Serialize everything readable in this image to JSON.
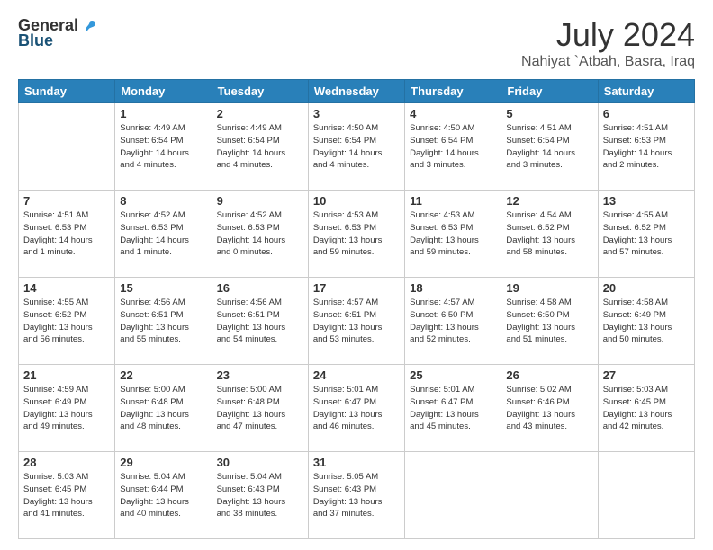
{
  "header": {
    "logo_general": "General",
    "logo_blue": "Blue",
    "month_year": "July 2024",
    "location": "Nahiyat `Atbah, Basra, Iraq"
  },
  "days_of_week": [
    "Sunday",
    "Monday",
    "Tuesday",
    "Wednesday",
    "Thursday",
    "Friday",
    "Saturday"
  ],
  "weeks": [
    [
      {
        "day": "",
        "info": ""
      },
      {
        "day": "1",
        "info": "Sunrise: 4:49 AM\nSunset: 6:54 PM\nDaylight: 14 hours\nand 4 minutes."
      },
      {
        "day": "2",
        "info": "Sunrise: 4:49 AM\nSunset: 6:54 PM\nDaylight: 14 hours\nand 4 minutes."
      },
      {
        "day": "3",
        "info": "Sunrise: 4:50 AM\nSunset: 6:54 PM\nDaylight: 14 hours\nand 4 minutes."
      },
      {
        "day": "4",
        "info": "Sunrise: 4:50 AM\nSunset: 6:54 PM\nDaylight: 14 hours\nand 3 minutes."
      },
      {
        "day": "5",
        "info": "Sunrise: 4:51 AM\nSunset: 6:54 PM\nDaylight: 14 hours\nand 3 minutes."
      },
      {
        "day": "6",
        "info": "Sunrise: 4:51 AM\nSunset: 6:53 PM\nDaylight: 14 hours\nand 2 minutes."
      }
    ],
    [
      {
        "day": "7",
        "info": "Sunrise: 4:51 AM\nSunset: 6:53 PM\nDaylight: 14 hours\nand 1 minute."
      },
      {
        "day": "8",
        "info": "Sunrise: 4:52 AM\nSunset: 6:53 PM\nDaylight: 14 hours\nand 1 minute."
      },
      {
        "day": "9",
        "info": "Sunrise: 4:52 AM\nSunset: 6:53 PM\nDaylight: 14 hours\nand 0 minutes."
      },
      {
        "day": "10",
        "info": "Sunrise: 4:53 AM\nSunset: 6:53 PM\nDaylight: 13 hours\nand 59 minutes."
      },
      {
        "day": "11",
        "info": "Sunrise: 4:53 AM\nSunset: 6:53 PM\nDaylight: 13 hours\nand 59 minutes."
      },
      {
        "day": "12",
        "info": "Sunrise: 4:54 AM\nSunset: 6:52 PM\nDaylight: 13 hours\nand 58 minutes."
      },
      {
        "day": "13",
        "info": "Sunrise: 4:55 AM\nSunset: 6:52 PM\nDaylight: 13 hours\nand 57 minutes."
      }
    ],
    [
      {
        "day": "14",
        "info": "Sunrise: 4:55 AM\nSunset: 6:52 PM\nDaylight: 13 hours\nand 56 minutes."
      },
      {
        "day": "15",
        "info": "Sunrise: 4:56 AM\nSunset: 6:51 PM\nDaylight: 13 hours\nand 55 minutes."
      },
      {
        "day": "16",
        "info": "Sunrise: 4:56 AM\nSunset: 6:51 PM\nDaylight: 13 hours\nand 54 minutes."
      },
      {
        "day": "17",
        "info": "Sunrise: 4:57 AM\nSunset: 6:51 PM\nDaylight: 13 hours\nand 53 minutes."
      },
      {
        "day": "18",
        "info": "Sunrise: 4:57 AM\nSunset: 6:50 PM\nDaylight: 13 hours\nand 52 minutes."
      },
      {
        "day": "19",
        "info": "Sunrise: 4:58 AM\nSunset: 6:50 PM\nDaylight: 13 hours\nand 51 minutes."
      },
      {
        "day": "20",
        "info": "Sunrise: 4:58 AM\nSunset: 6:49 PM\nDaylight: 13 hours\nand 50 minutes."
      }
    ],
    [
      {
        "day": "21",
        "info": "Sunrise: 4:59 AM\nSunset: 6:49 PM\nDaylight: 13 hours\nand 49 minutes."
      },
      {
        "day": "22",
        "info": "Sunrise: 5:00 AM\nSunset: 6:48 PM\nDaylight: 13 hours\nand 48 minutes."
      },
      {
        "day": "23",
        "info": "Sunrise: 5:00 AM\nSunset: 6:48 PM\nDaylight: 13 hours\nand 47 minutes."
      },
      {
        "day": "24",
        "info": "Sunrise: 5:01 AM\nSunset: 6:47 PM\nDaylight: 13 hours\nand 46 minutes."
      },
      {
        "day": "25",
        "info": "Sunrise: 5:01 AM\nSunset: 6:47 PM\nDaylight: 13 hours\nand 45 minutes."
      },
      {
        "day": "26",
        "info": "Sunrise: 5:02 AM\nSunset: 6:46 PM\nDaylight: 13 hours\nand 43 minutes."
      },
      {
        "day": "27",
        "info": "Sunrise: 5:03 AM\nSunset: 6:45 PM\nDaylight: 13 hours\nand 42 minutes."
      }
    ],
    [
      {
        "day": "28",
        "info": "Sunrise: 5:03 AM\nSunset: 6:45 PM\nDaylight: 13 hours\nand 41 minutes."
      },
      {
        "day": "29",
        "info": "Sunrise: 5:04 AM\nSunset: 6:44 PM\nDaylight: 13 hours\nand 40 minutes."
      },
      {
        "day": "30",
        "info": "Sunrise: 5:04 AM\nSunset: 6:43 PM\nDaylight: 13 hours\nand 38 minutes."
      },
      {
        "day": "31",
        "info": "Sunrise: 5:05 AM\nSunset: 6:43 PM\nDaylight: 13 hours\nand 37 minutes."
      },
      {
        "day": "",
        "info": ""
      },
      {
        "day": "",
        "info": ""
      },
      {
        "day": "",
        "info": ""
      }
    ]
  ]
}
